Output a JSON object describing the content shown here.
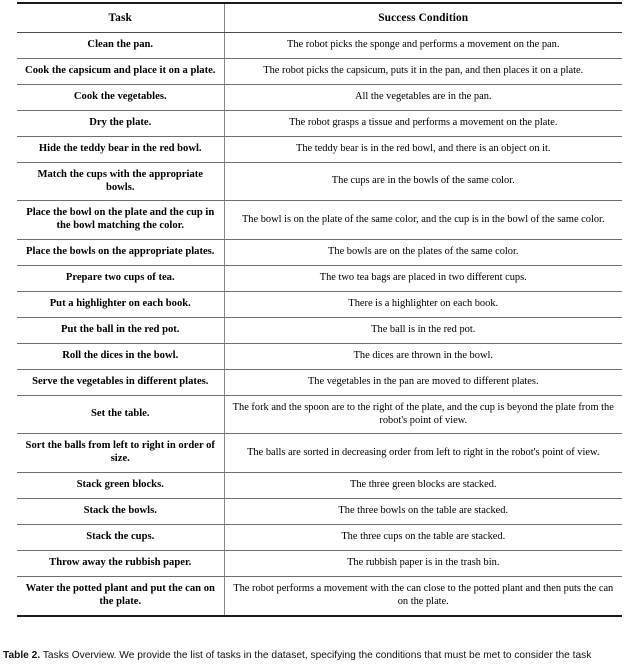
{
  "table": {
    "columns": [
      "Task",
      "Success Condition"
    ],
    "rows": [
      {
        "task": "Clean the pan.",
        "condition": "The robot picks the sponge and performs a movement on the pan."
      },
      {
        "task": "Cook the capsicum and place it on a plate.",
        "condition": "The robot picks the capsicum, puts it in the pan, and then places it on a plate."
      },
      {
        "task": "Cook the vegetables.",
        "condition": "All the vegetables are in the pan."
      },
      {
        "task": "Dry the plate.",
        "condition": "The robot grasps a tissue and performs a movement on the plate."
      },
      {
        "task": "Hide the teddy bear in the red bowl.",
        "condition": "The teddy bear is in the red bowl, and there is an object on it."
      },
      {
        "task": "Match the cups with the appropriate bowls.",
        "condition": "The cups are in the bowls of the same color."
      },
      {
        "task": "Place the bowl on the plate and the cup in the bowl matching the color.",
        "condition": "The bowl is on the plate of the same color, and the cup is in the bowl of the same color."
      },
      {
        "task": "Place the bowls on the appropriate plates.",
        "condition": "The bowls are on the plates of the same color."
      },
      {
        "task": "Prepare two cups of tea.",
        "condition": "The two tea bags are placed in two different cups."
      },
      {
        "task": "Put a highlighter on each book.",
        "condition": "There is a highlighter on each book."
      },
      {
        "task": "Put the ball in the red pot.",
        "condition": "The ball is in the red pot."
      },
      {
        "task": "Roll the dices in the bowl.",
        "condition": "The dices are thrown in the bowl."
      },
      {
        "task": "Serve the vegetables in different plates.",
        "condition": "The vegetables in the pan are moved to different plates."
      },
      {
        "task": "Set the table.",
        "condition": "The fork and the spoon are to the right of the plate, and the cup is beyond the plate from the robot's point of view."
      },
      {
        "task": "Sort the balls from left to right in order of size.",
        "condition": "The balls are sorted in decreasing order from left to right in the robot's point of view."
      },
      {
        "task": "Stack green blocks.",
        "condition": "The three green blocks are stacked."
      },
      {
        "task": "Stack the bowls.",
        "condition": "The three bowls on the table are stacked."
      },
      {
        "task": "Stack the cups.",
        "condition": "The three cups on the table are stacked."
      },
      {
        "task": "Throw away the rubbish paper.",
        "condition": "The rubbish paper is in the trash bin."
      },
      {
        "task": "Water the potted plant and put the can on the plate.",
        "condition": "The robot performs a movement with the can close to the potted plant and then puts the can on the plate."
      }
    ]
  },
  "caption": {
    "label": "Table 2.",
    "text": "Tasks Overview. We provide the list of tasks in the dataset, specifying the conditions that must be met to consider the task"
  }
}
